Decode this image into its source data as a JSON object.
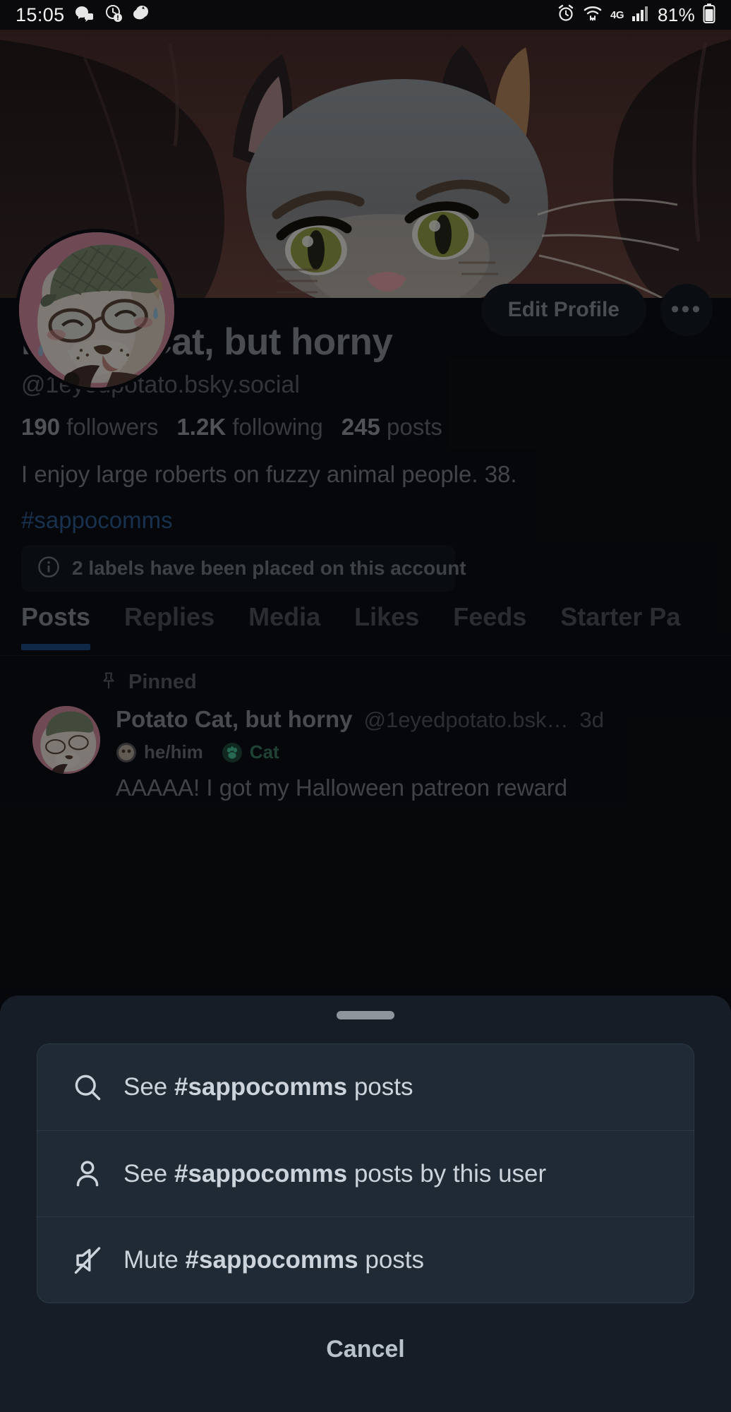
{
  "statusbar": {
    "time": "15:05",
    "battery": "81%",
    "network_label": "4G",
    "left_icons": [
      "discord-icon",
      "watch-alert-icon",
      "leaf-app-icon"
    ],
    "right_icons": [
      "alarm-icon",
      "wifi-icon",
      "network-4g-icon",
      "signal-bars-icon",
      "battery-icon"
    ]
  },
  "profile": {
    "display_name": "Potato Cat, but horny",
    "handle": "@1eyedpotato.bsky.social",
    "stats": [
      {
        "value": "190",
        "label": "followers"
      },
      {
        "value": "1.2K",
        "label": "following"
      },
      {
        "value": "245",
        "label": "posts"
      }
    ],
    "bio": "I enjoy large roberts on fuzzy animal people. 38.",
    "hashtag": "#sappocomms",
    "labels_notice": "2 labels have been placed on this account",
    "edit_button": "Edit Profile",
    "more_button": "•••"
  },
  "tabs": [
    {
      "label": "Posts",
      "active": true
    },
    {
      "label": "Replies",
      "active": false
    },
    {
      "label": "Media",
      "active": false
    },
    {
      "label": "Likes",
      "active": false
    },
    {
      "label": "Feeds",
      "active": false
    },
    {
      "label": "Starter Pa",
      "active": false
    }
  ],
  "pinned_post": {
    "pinned_label": "Pinned",
    "author_name": "Potato Cat, but horny",
    "author_handle": "@1eyedpotato.bsk…",
    "timestamp": "3d",
    "pronoun_badge": "he/him",
    "species_badge": "Cat",
    "text": "AAAAA! I got my Halloween patreon reward"
  },
  "sheet": {
    "items": [
      {
        "icon": "search-icon",
        "prefix": "See ",
        "tag": "#sappocomms",
        "suffix": " posts"
      },
      {
        "icon": "person-icon",
        "prefix": "See ",
        "tag": "#sappocomms",
        "suffix": " posts by this user"
      },
      {
        "icon": "mute-icon",
        "prefix": "Mute ",
        "tag": "#sappocomms",
        "suffix": " posts"
      }
    ],
    "cancel_label": "Cancel"
  },
  "colors": {
    "accent_blue": "#1d4e89",
    "link_blue": "#2c5e96",
    "sheet_bg": "#161d26",
    "card_bg": "#1f2a35",
    "page_bg": "#0b0f14",
    "species_green": "#3c7f66"
  }
}
